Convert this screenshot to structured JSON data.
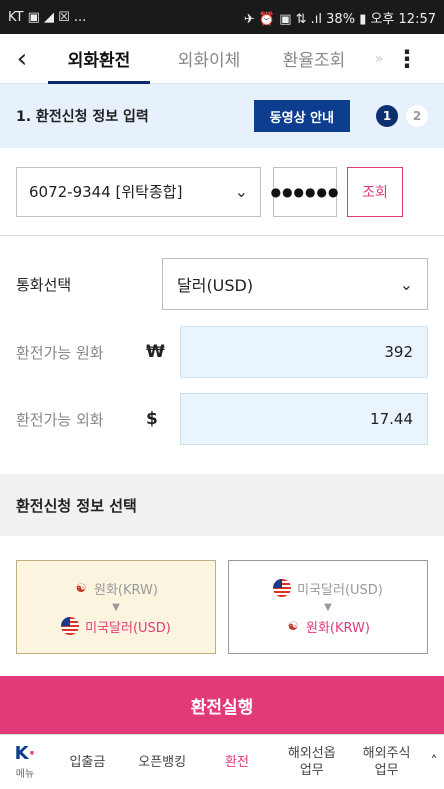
{
  "statusbar": {
    "left": "KT ▣ ◢ ☒ ...",
    "right": "✈ ⏰ ▣ ⇅ .ıl 38% ▮ 오후 12:57"
  },
  "header": {
    "back_icon": "chevron-left-icon",
    "tabs": [
      {
        "label": "외화환전",
        "active": true
      },
      {
        "label": "외화이체",
        "active": false
      },
      {
        "label": "환율조회",
        "active": false
      }
    ],
    "more_indicator": "»",
    "kebab": "⋮"
  },
  "stepbar": {
    "title": "1. 환전신청 정보 입력",
    "video_button": "동영상 안내",
    "steps": [
      "1",
      "2"
    ],
    "current_step": 1
  },
  "account": {
    "number": "6072-9344 [위탁종합]",
    "password_mask": "●●●●●●",
    "lookup_button": "조회"
  },
  "form": {
    "currency_label": "통화선택",
    "currency_value": "달러(USD)",
    "krw_label": "환전가능 원화",
    "krw_symbol": "₩",
    "krw_value": "392",
    "fx_label": "환전가능 외화",
    "fx_symbol": "$",
    "fx_value": "17.44"
  },
  "section_title": "환전신청 정보 선택",
  "choices": [
    {
      "from": "원화(KRW)",
      "to": "미국달러(USD)",
      "selected": true
    },
    {
      "from": "미국달러(USD)",
      "to": "원화(KRW)",
      "selected": false
    }
  ],
  "exec_button": "환전실행",
  "bottomnav": {
    "menu_label": "메뉴",
    "items": [
      "입출금",
      "오픈뱅킹",
      "환전",
      "해외선옵\n업무",
      "해외주식\n업무"
    ],
    "active_index": 2
  },
  "colors": {
    "accent_pink": "#e23a79",
    "navy": "#0c3d8e",
    "step_bg": "#e6f1fb"
  }
}
